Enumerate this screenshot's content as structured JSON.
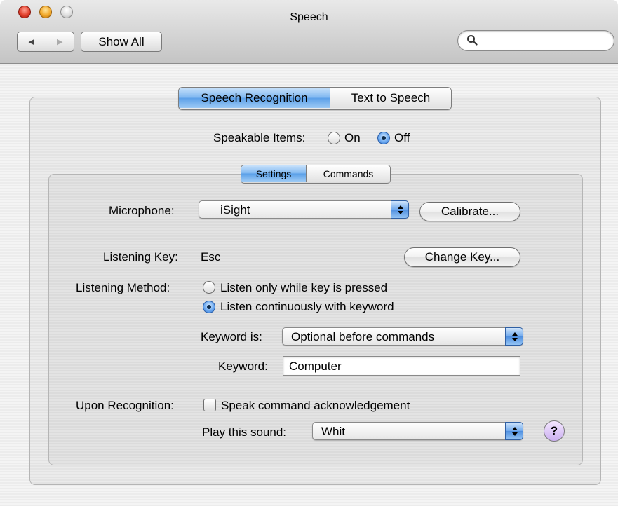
{
  "window": {
    "title": "Speech"
  },
  "toolbar": {
    "back_icon": "back-arrow-icon",
    "forward_icon": "forward-arrow-icon",
    "show_all_label": "Show All",
    "search_placeholder": "",
    "search_icon": "magnifier-icon"
  },
  "main_tabs": [
    {
      "label": "Speech Recognition",
      "selected": true
    },
    {
      "label": "Text to Speech",
      "selected": false
    }
  ],
  "speakable_items": {
    "label": "Speakable Items:",
    "on_label": "On",
    "off_label": "Off",
    "selected": "Off"
  },
  "sub_tabs": [
    {
      "label": "Settings",
      "selected": true
    },
    {
      "label": "Commands",
      "selected": false
    }
  ],
  "settings": {
    "microphone_label": "Microphone:",
    "microphone_value": "iSight",
    "calibrate_label": "Calibrate...",
    "listening_key_label": "Listening Key:",
    "listening_key_value": "Esc",
    "change_key_label": "Change Key...",
    "listening_method_label": "Listening Method:",
    "method_option_1": "Listen only while key is pressed",
    "method_option_2": "Listen continuously with keyword",
    "method_selected": 2,
    "keyword_is_label": "Keyword is:",
    "keyword_is_value": "Optional before commands",
    "keyword_label": "Keyword:",
    "keyword_value": "Computer",
    "upon_recognition_label": "Upon Recognition:",
    "speak_ack_label": "Speak command acknowledgement",
    "speak_ack_checked": false,
    "play_sound_label": "Play this sound:",
    "play_sound_value": "Whit",
    "help_label": "?"
  },
  "colors": {
    "selected_tab": "#6aa8ee",
    "radio_selected": "#4a8de0",
    "help_button": "#d9c4f5"
  }
}
